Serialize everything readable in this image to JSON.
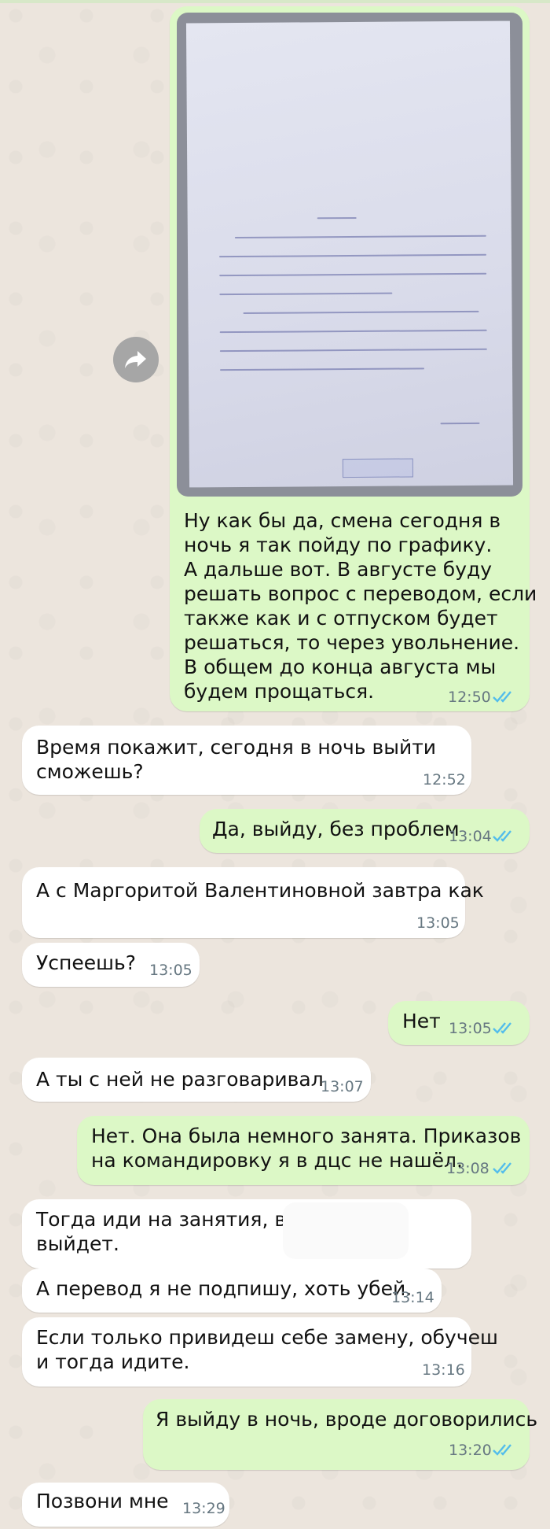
{
  "colors": {
    "background": "#ece5dd",
    "incoming_bubble": "#ffffff",
    "outgoing_bubble": "#dcf8c6",
    "timestamp": "#667781",
    "read_ticks": "#53bdeb"
  },
  "forward_button": {
    "icon": "forward-arrow-icon"
  },
  "messages": [
    {
      "direction": "outgoing",
      "has_photo": true,
      "lines": [
        "Ну как бы да, смена сегодня в",
        "ночь я так пойду по графику.",
        "А дальше вот. В августе буду",
        "решать вопрос с переводом, если",
        "также как и с отпуском  будет",
        "решаться, то через увольнение.",
        "В общем до конца августа мы",
        "будем прощаться."
      ],
      "time": "12:50",
      "status": "read"
    },
    {
      "direction": "incoming",
      "lines": [
        "Время покажит, сегодня в ночь выйти",
        "сможешь?"
      ],
      "time": "12:52"
    },
    {
      "direction": "outgoing",
      "lines": [
        "Да, выйду, без проблем"
      ],
      "time": "13:04",
      "status": "read"
    },
    {
      "direction": "incoming",
      "lines": [
        "А с Маргоритой Валентиновной завтра как"
      ],
      "time": "13:05"
    },
    {
      "direction": "incoming",
      "lines": [
        "Успеешь?"
      ],
      "time": "13:05"
    },
    {
      "direction": "outgoing",
      "lines": [
        "Нет"
      ],
      "time": "13:05",
      "status": "read"
    },
    {
      "direction": "incoming",
      "lines": [
        "А ты с ней не разговаривал"
      ],
      "time": "13:07"
    },
    {
      "direction": "outgoing",
      "lines": [
        "Нет. Она была немного занята. Приказов",
        "на командировку я в дцс не нашёл."
      ],
      "time": "13:08",
      "status": "read"
    },
    {
      "direction": "incoming",
      "lines": [
        "Тогда иди на занятия, в ночь",
        "выйдет."
      ],
      "time": ""
    },
    {
      "direction": "incoming",
      "lines": [
        "А перевод я не подпишу, хоть убей."
      ],
      "time": "13:14"
    },
    {
      "direction": "incoming",
      "lines": [
        "Если только привидеш себе замену, обучеш",
        "и тогда идите."
      ],
      "time": "13:16"
    },
    {
      "direction": "outgoing",
      "lines": [
        "Я выйду в ночь, вроде договорились"
      ],
      "time": "13:20",
      "status": "read"
    },
    {
      "direction": "incoming",
      "lines": [
        "Позвони мне"
      ],
      "time": "13:29"
    }
  ]
}
